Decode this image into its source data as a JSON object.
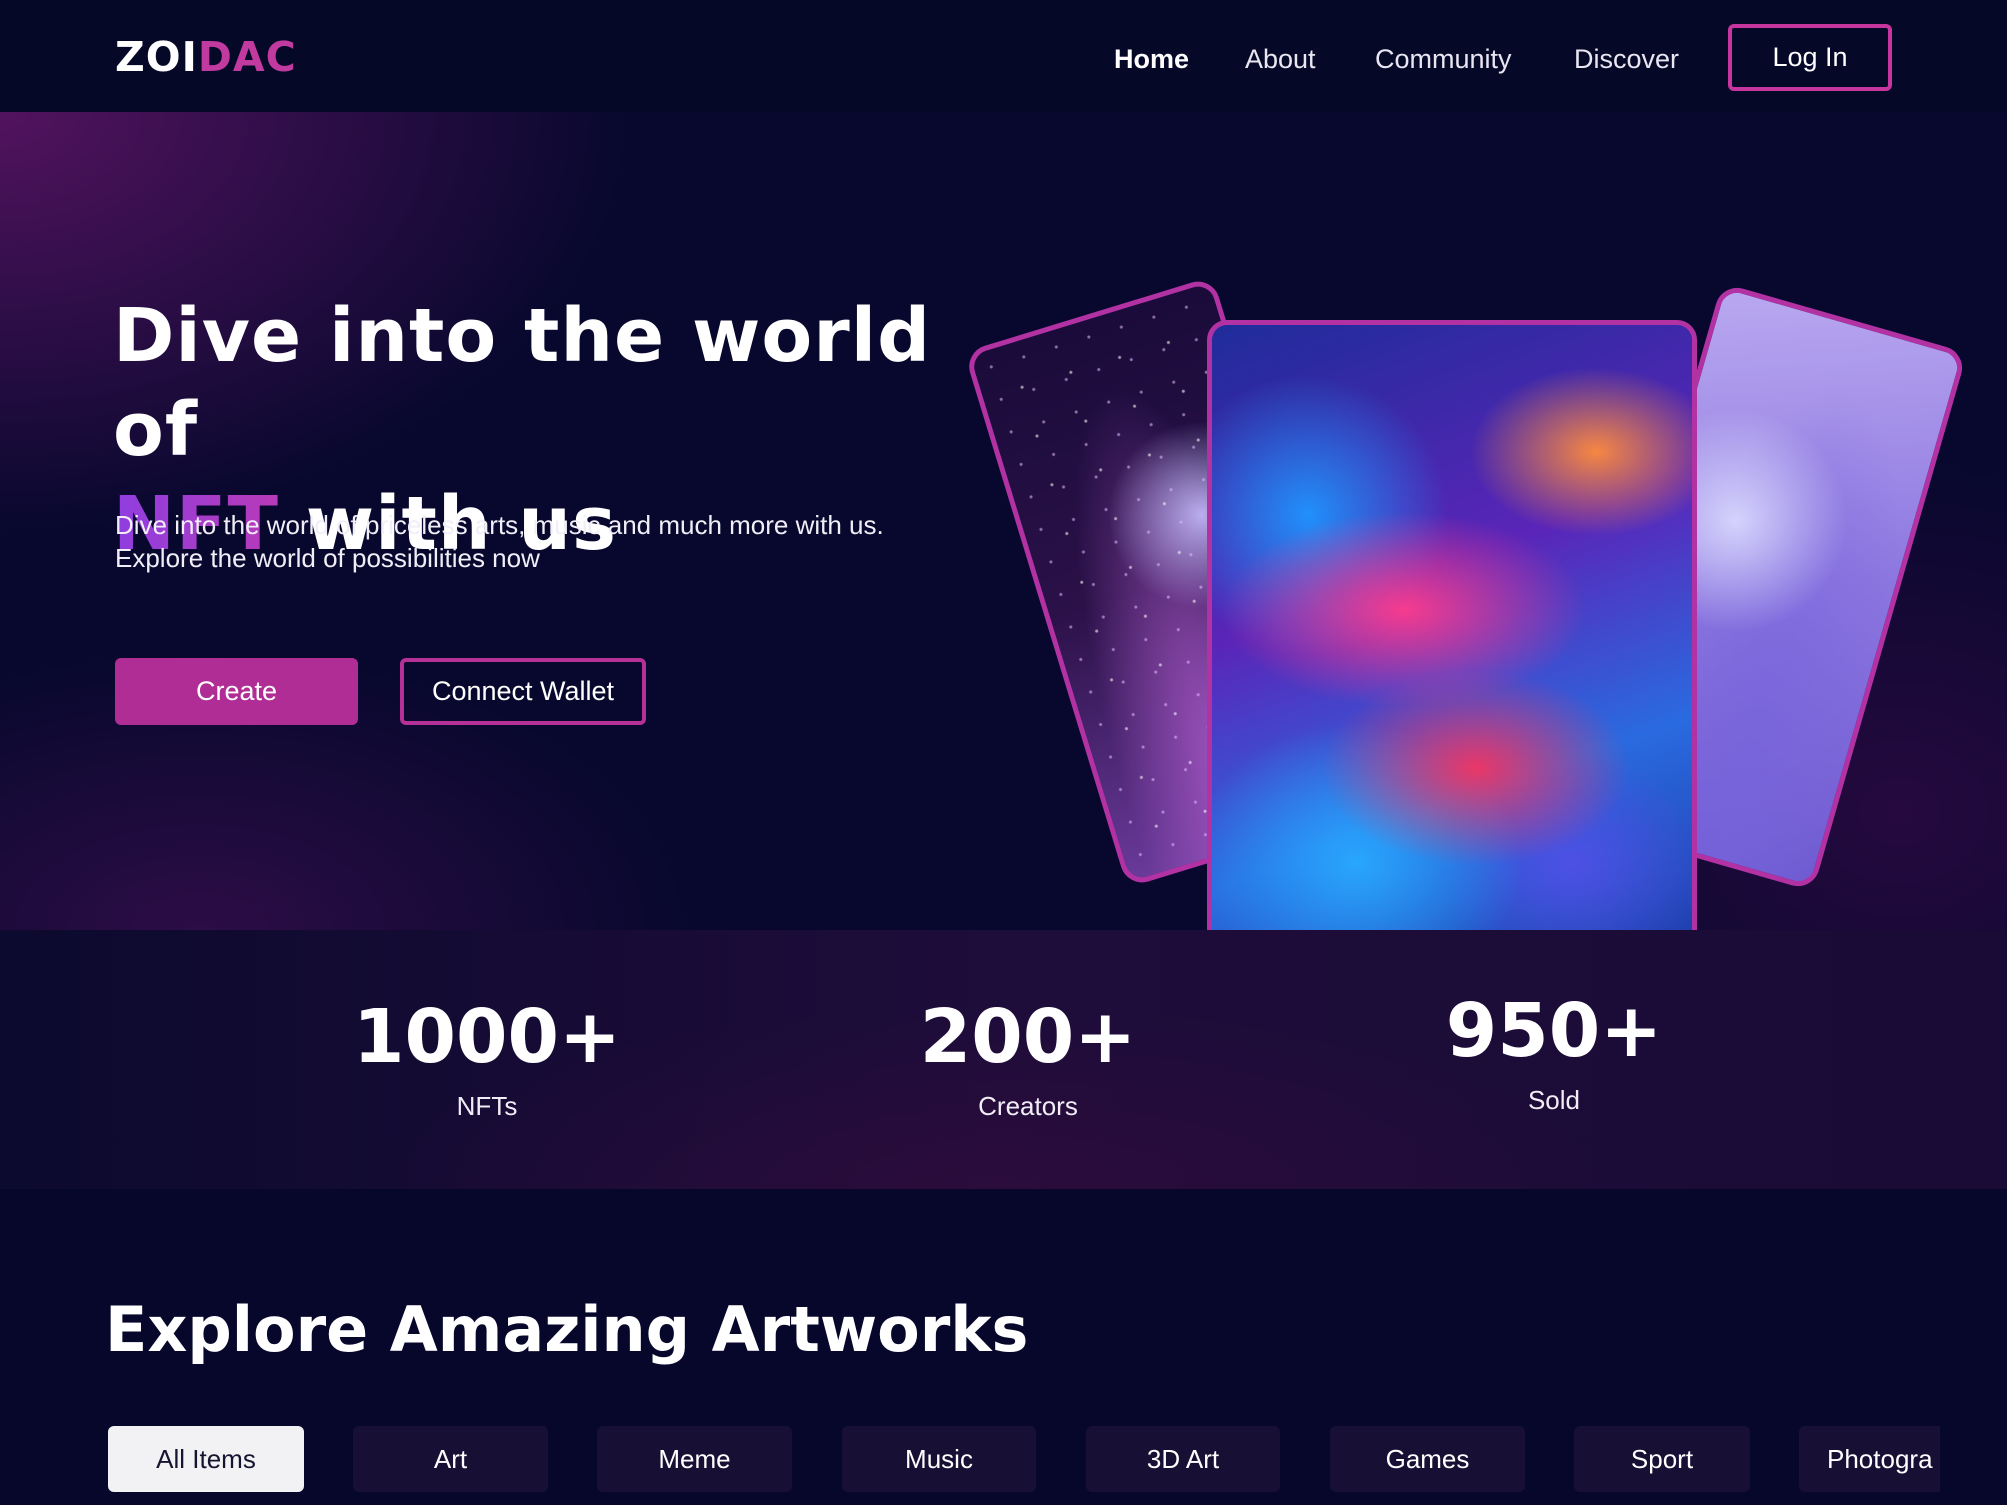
{
  "navbar": {
    "logo_part1": "ZOI",
    "logo_part2": "DAC",
    "links": [
      {
        "label": "Home",
        "active": true
      },
      {
        "label": "About",
        "active": false
      },
      {
        "label": "Community",
        "active": false
      },
      {
        "label": "Discover",
        "active": false
      }
    ],
    "login_label": "Log In"
  },
  "hero": {
    "title_line1": "Dive into the world of",
    "title_accent": "NFT",
    "title_rest": " with us",
    "subtitle": "Dive into the world of priceless arts, music and much more with us. Explore the world of possibilities now",
    "create_label": "Create",
    "wallet_label": "Connect Wallet"
  },
  "stats": [
    {
      "value": "1000+",
      "label": "NFTs"
    },
    {
      "value": "200+",
      "label": "Creators"
    },
    {
      "value": "950+",
      "label": "Sold"
    }
  ],
  "explore": {
    "title": "Explore Amazing Artworks",
    "filters": [
      "All Items",
      "Art",
      "Meme",
      "Music",
      "3D Art",
      "Games",
      "Sport",
      "Photogra"
    ],
    "active_filter": "All Items"
  },
  "colors": {
    "background": "#06072a",
    "accent": "#b02d95",
    "accent_purple": "#8f3ee0"
  }
}
